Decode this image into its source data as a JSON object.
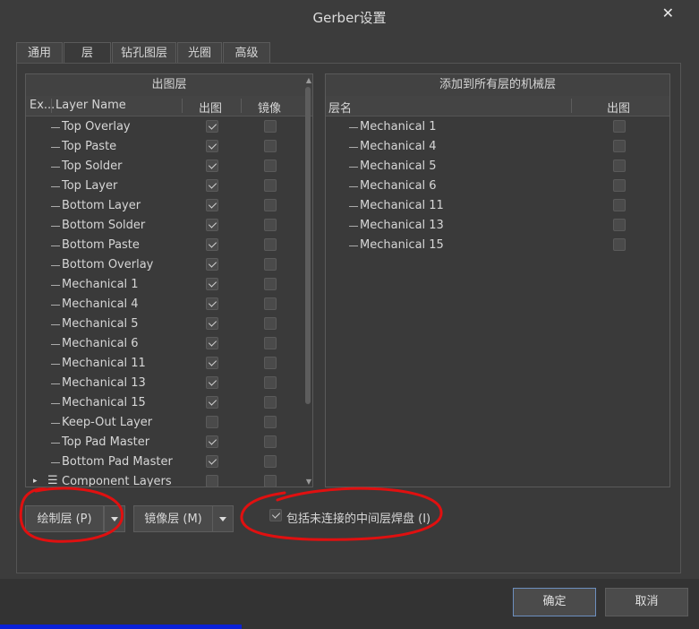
{
  "window": {
    "title": "Gerber设置",
    "close_icon": "close-icon"
  },
  "tabs": [
    {
      "label": "通用",
      "active": false
    },
    {
      "label": "层",
      "active": true
    },
    {
      "label": "钻孔图层",
      "active": false
    },
    {
      "label": "光圈",
      "active": false
    },
    {
      "label": "高级",
      "active": false
    }
  ],
  "left_panel": {
    "title": "出图层",
    "columns": {
      "expand": "Ex...",
      "name": "Layer Name",
      "plot": "出图",
      "mirror": "镜像"
    },
    "rows": [
      {
        "name": "Top Overlay",
        "plot": true,
        "mirror": false
      },
      {
        "name": "Top Paste",
        "plot": true,
        "mirror": false
      },
      {
        "name": "Top Solder",
        "plot": true,
        "mirror": false
      },
      {
        "name": "Top Layer",
        "plot": true,
        "mirror": false
      },
      {
        "name": "Bottom Layer",
        "plot": true,
        "mirror": false
      },
      {
        "name": "Bottom Solder",
        "plot": true,
        "mirror": false
      },
      {
        "name": "Bottom Paste",
        "plot": true,
        "mirror": false
      },
      {
        "name": "Bottom Overlay",
        "plot": true,
        "mirror": false
      },
      {
        "name": "Mechanical 1",
        "plot": true,
        "mirror": false
      },
      {
        "name": "Mechanical 4",
        "plot": true,
        "mirror": false
      },
      {
        "name": "Mechanical 5",
        "plot": true,
        "mirror": false
      },
      {
        "name": "Mechanical 6",
        "plot": true,
        "mirror": false
      },
      {
        "name": "Mechanical 11",
        "plot": true,
        "mirror": false
      },
      {
        "name": "Mechanical 13",
        "plot": true,
        "mirror": false
      },
      {
        "name": "Mechanical 15",
        "plot": true,
        "mirror": false
      },
      {
        "name": "Keep-Out Layer",
        "plot": false,
        "mirror": false
      },
      {
        "name": "Top Pad Master",
        "plot": true,
        "mirror": false
      },
      {
        "name": "Bottom Pad Master",
        "plot": true,
        "mirror": false
      },
      {
        "name": "Component Layers",
        "plot": false,
        "mirror": false
      }
    ]
  },
  "right_panel": {
    "title": "添加到所有层的机械层",
    "columns": {
      "name": "层名",
      "plot": "出图"
    },
    "rows": [
      {
        "name": "Mechanical 1",
        "plot": false
      },
      {
        "name": "Mechanical 4",
        "plot": false
      },
      {
        "name": "Mechanical 5",
        "plot": false
      },
      {
        "name": "Mechanical 6",
        "plot": false
      },
      {
        "name": "Mechanical 11",
        "plot": false
      },
      {
        "name": "Mechanical 13",
        "plot": false
      },
      {
        "name": "Mechanical 15",
        "plot": false
      }
    ]
  },
  "controls": {
    "plot_layers_button": "绘制层 (P)",
    "mirror_layers_button": "镜像层 (M)",
    "include_unconnected_label": "包括未连接的中间层焊盘 (I)",
    "include_unconnected_checked": true
  },
  "footer": {
    "ok": "确定",
    "cancel": "取消"
  },
  "colors": {
    "background": "#3c3c3c",
    "annotation_red": "#e01010",
    "ok_border": "#6d8fbf"
  }
}
